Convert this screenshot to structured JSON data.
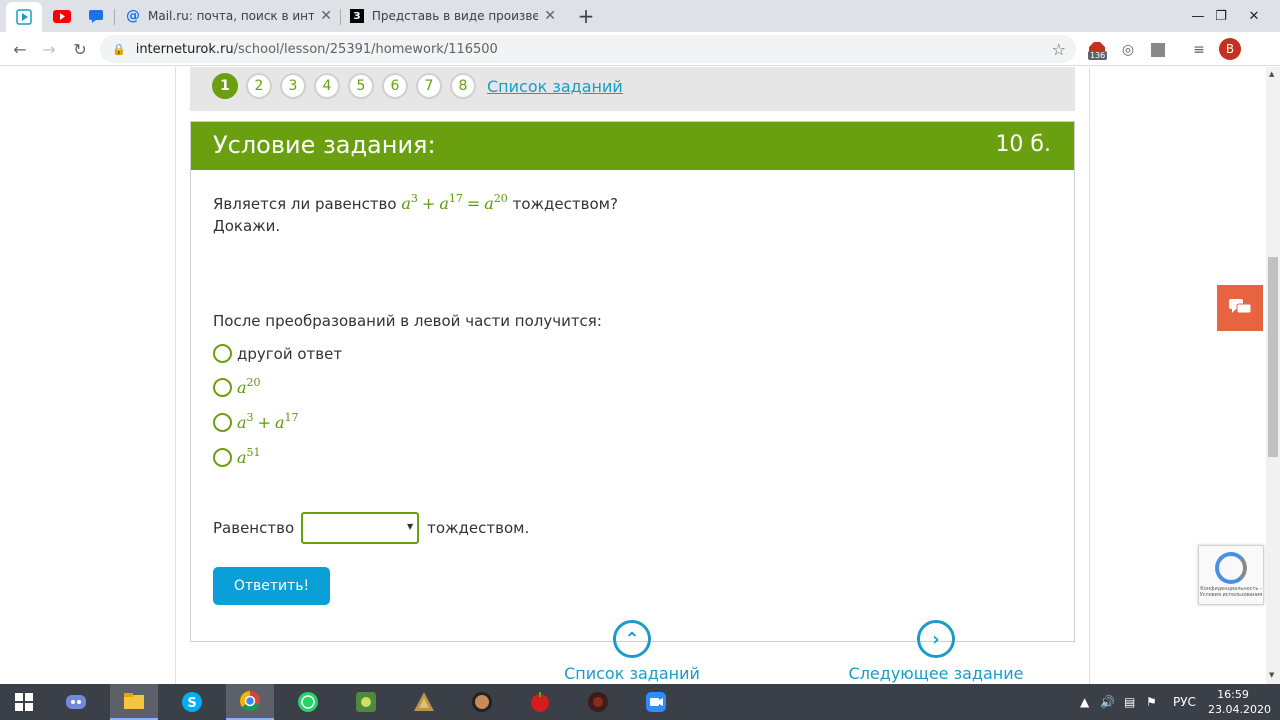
{
  "browser": {
    "tabs": [
      {
        "title": "Mail.ru: почта, поиск в интерне",
        "close": "✕"
      },
      {
        "title": "Представь в виде произведени",
        "close": "✕"
      }
    ],
    "new_tab": "+",
    "window_controls": {
      "minimize": "—",
      "maximize": "❐",
      "close": "✕"
    },
    "url_host": "interneturok.ru",
    "url_path": "/school/lesson/25391/homework/116500",
    "badge_count": "136",
    "profile_initial": "B"
  },
  "task_nav": {
    "numbers": [
      "1",
      "2",
      "3",
      "4",
      "5",
      "6",
      "7",
      "8"
    ],
    "active_index": 0,
    "list_link": "Список заданий"
  },
  "task": {
    "header_title": "Условие задания:",
    "points": "10 б.",
    "question_prefix": "Является ли равенство",
    "question_suffix": "тождеством?",
    "question_line2": "Докажи.",
    "equation": {
      "base": "a",
      "p1": "3",
      "op1": "+",
      "p2": "17",
      "op2": "=",
      "p3": "20"
    },
    "sub_question": "После преобразований в левой части получится:",
    "options": [
      {
        "text": "другой ответ"
      },
      {
        "base": "a",
        "power": "20"
      },
      {
        "base": "a",
        "power": "3",
        "op": "+",
        "power2": "17"
      },
      {
        "base": "a",
        "power": "51"
      }
    ],
    "equality_prefix": "Равенство",
    "equality_suffix": "тождеством.",
    "select_value": "",
    "answer_button": "Ответить!"
  },
  "bottom_nav": {
    "list_label": "Список заданий",
    "next_label": "Следующее задание"
  },
  "recaptcha_text": "Конфиденциальность - Условия использования",
  "taskbar": {
    "language": "РУС",
    "time": "16:59",
    "date": "23.04.2020"
  },
  "colors": {
    "accent_green": "#6aa00f",
    "link_blue": "#1a9bc8",
    "button_blue": "#0b9fd8",
    "chat_orange": "#e8633f"
  }
}
